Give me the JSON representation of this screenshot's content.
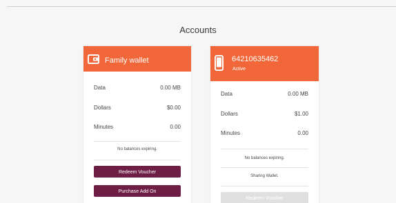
{
  "page": {
    "title": "Accounts"
  },
  "accounts": [
    {
      "name": "Family wallet",
      "icon": "wallet-icon",
      "rows": [
        {
          "label": "Data",
          "value": "0.00 MB"
        },
        {
          "label": "Dollars",
          "value": "$0.00"
        },
        {
          "label": "Minutes",
          "value": "0.00"
        }
      ],
      "note": "No balances expiring.",
      "buttons": {
        "redeem": "Redeem Voucher",
        "purchase": "Purchase Add On"
      }
    },
    {
      "name": "64210635462",
      "status": "Active",
      "icon": "phone-icon",
      "rows": [
        {
          "label": "Data",
          "value": "0.00 MB"
        },
        {
          "label": "Dollars",
          "value": "$1.00"
        },
        {
          "label": "Minutes",
          "value": "0.00"
        }
      ],
      "note": "No balances expiring.",
      "sharing": "Sharing Wallet.",
      "buttons": {
        "redeem": "Redeem Voucher"
      }
    }
  ],
  "colors": {
    "header": "#f2673a",
    "primary_button": "#6e1e45",
    "disabled_button": "#e0e0e0"
  }
}
